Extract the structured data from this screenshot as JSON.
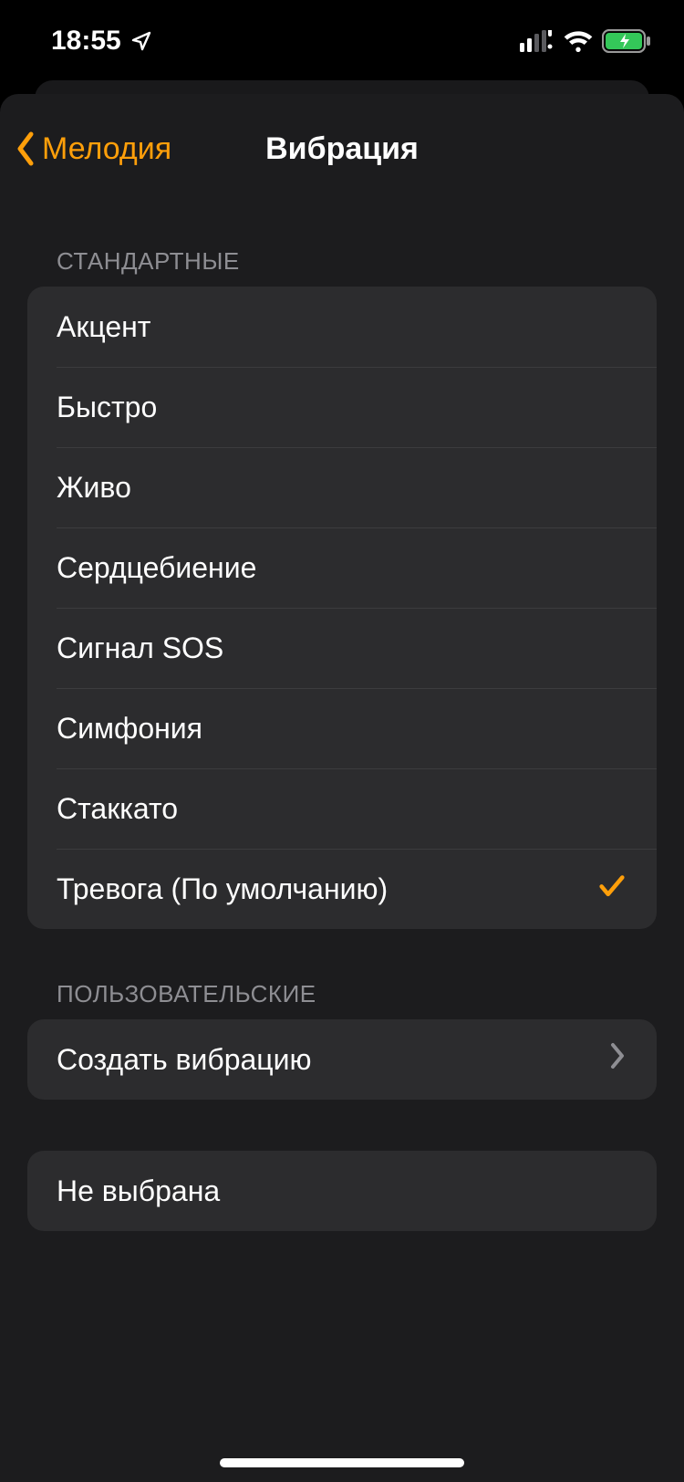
{
  "status": {
    "time": "18:55"
  },
  "nav": {
    "back_label": "Мелодия",
    "title": "Вибрация"
  },
  "sections": {
    "standard_header": "СТАНДАРТНЫЕ",
    "custom_header": "ПОЛЬЗОВАТЕЛЬСКИЕ"
  },
  "standard_items": [
    {
      "label": "Акцент",
      "selected": false
    },
    {
      "label": "Быстро",
      "selected": false
    },
    {
      "label": "Живо",
      "selected": false
    },
    {
      "label": "Сердцебиение",
      "selected": false
    },
    {
      "label": "Сигнал SOS",
      "selected": false
    },
    {
      "label": "Симфония",
      "selected": false
    },
    {
      "label": "Стаккато",
      "selected": false
    },
    {
      "label": "Тревога (По умолчанию)",
      "selected": true
    }
  ],
  "custom_items": [
    {
      "label": "Создать вибрацию",
      "disclosure": true
    }
  ],
  "none_items": [
    {
      "label": "Не выбрана"
    }
  ],
  "colors": {
    "accent": "#ff9f0a"
  }
}
